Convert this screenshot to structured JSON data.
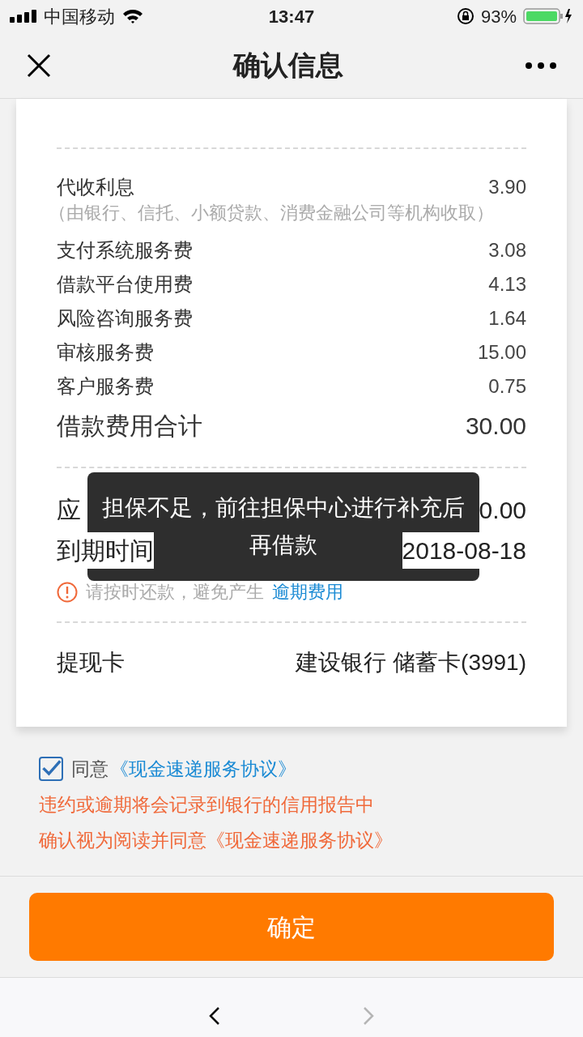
{
  "status_bar": {
    "carrier": "中国移动",
    "time": "13:47",
    "battery": "93%"
  },
  "nav": {
    "title": "确认信息"
  },
  "fees": [
    {
      "label": "代收利息",
      "value": "3.90",
      "note": "（由银行、信托、小额贷款、消费金融公司等机构收取）"
    },
    {
      "label": "支付系统服务费",
      "value": "3.08"
    },
    {
      "label": "借款平台使用费",
      "value": "4.13"
    },
    {
      "label": "风险咨询服务费",
      "value": "1.64"
    },
    {
      "label": "审核服务费",
      "value": "15.00"
    },
    {
      "label": "客户服务费",
      "value": "0.75"
    }
  ],
  "total": {
    "label": "借款费用合计",
    "value": "30.00"
  },
  "repayment": [
    {
      "label": "应",
      "value": "0.00"
    },
    {
      "label": "到期时间",
      "value": "2018-08-18"
    }
  ],
  "warning": {
    "text": "请按时还款，避免产生",
    "link": "逾期费用"
  },
  "withdraw_card": {
    "label": "提现卡",
    "value": "建设银行 储蓄卡(3991)"
  },
  "agreement": {
    "checked": true,
    "prefix": "同意",
    "link": "《现金速递服务协议》"
  },
  "notices": [
    "违约或逾期将会记录到银行的信用报告中",
    "确认视为阅读并同意《现金速递服务协议》"
  ],
  "confirm_button": "确定",
  "toast": "担保不足，前往担保中心进行补充后再借款",
  "browser_nav": [
    {
      "kind": "back",
      "disabled": false
    },
    {
      "kind": "forward",
      "disabled": true
    }
  ]
}
